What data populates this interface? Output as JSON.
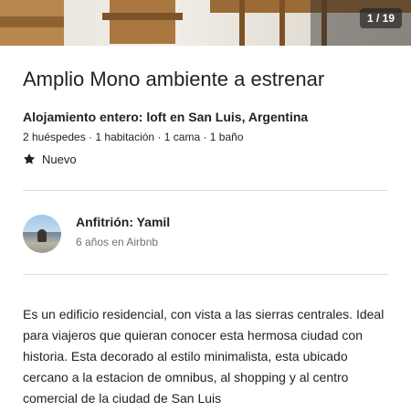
{
  "gallery": {
    "counter": "1 / 19"
  },
  "listing": {
    "title": "Amplio Mono ambiente a estrenar",
    "subtitle": "Alojamiento entero: loft en San Luis, Argentina",
    "details": "2 huéspedes · 1 habitación · 1 cama · 1 baño",
    "badge_label": "Nuevo",
    "badge_icon": "star-icon"
  },
  "host": {
    "name_label": "Anfitrión: Yamil",
    "years": "6 años en Airbnb"
  },
  "description": {
    "text": "Es un edificio residencial, con vista a las sierras centrales. Ideal para viajeros que quieran conocer esta hermosa ciudad con historia. Esta decorado al estilo minimalista, esta ubicado cercano a la estacion de omnibus, al shopping y al centro comercial de la ciudad de San Luis"
  },
  "colors": {
    "text_primary": "#222222",
    "text_secondary": "#717171",
    "divider": "#dddddd"
  }
}
